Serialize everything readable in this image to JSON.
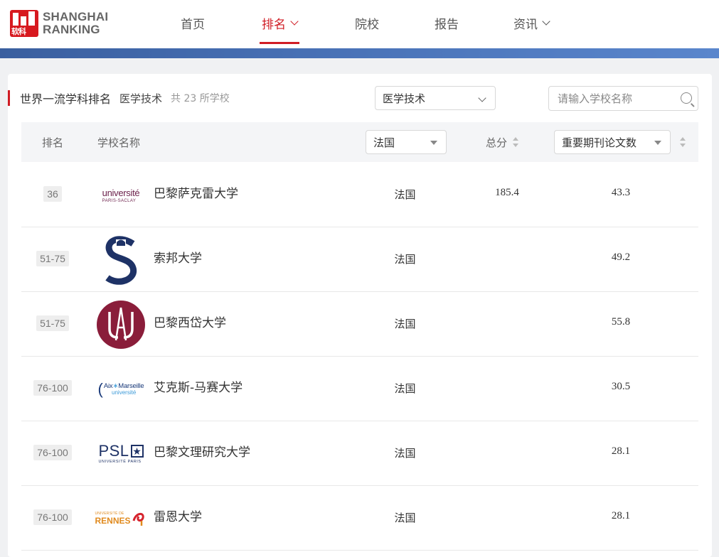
{
  "brand": {
    "cn": "软科",
    "line1": "SHANGHAI",
    "line2": "RANKING",
    "color": "#d7191f"
  },
  "nav": {
    "items": [
      {
        "label": "首页",
        "dropdown": false,
        "active": false
      },
      {
        "label": "排名",
        "dropdown": true,
        "active": true
      },
      {
        "label": "院校",
        "dropdown": false,
        "active": false
      },
      {
        "label": "报告",
        "dropdown": false,
        "active": false
      },
      {
        "label": "资讯",
        "dropdown": true,
        "active": false
      }
    ],
    "active_color": "#d01c24"
  },
  "page": {
    "title": "世界一流学科排名",
    "subject": "医学技术",
    "count": "共 23 所学校"
  },
  "subject_select": {
    "value": "医学技术"
  },
  "search": {
    "placeholder": "请输入学校名称"
  },
  "table": {
    "headers": {
      "rank": "排名",
      "name": "学校名称",
      "country_filter": "法国",
      "score": "总分",
      "indicator": "重要期刊论文数"
    },
    "rows": [
      {
        "rank": "36",
        "name": "巴黎萨克雷大学",
        "logo": "universite-paris-saclay-logo",
        "logo_text": [
          "universit",
          "PARIS-SACLAY"
        ],
        "country": "法国",
        "score": "185.4",
        "papers": "43.3"
      },
      {
        "rank": "51-75",
        "name": "索邦大学",
        "logo": "sorbonne-logo",
        "country": "法国",
        "score": "",
        "papers": "49.2"
      },
      {
        "rank": "51-75",
        "name": "巴黎西岱大学",
        "logo": "universite-paris-cite-logo",
        "country": "法国",
        "score": "",
        "papers": "55.8"
      },
      {
        "rank": "76-100",
        "name": "艾克斯-马赛大学",
        "logo": "aix-marseille-logo",
        "logo_text": [
          "Aix",
          "Marseille",
          "université"
        ],
        "country": "法国",
        "score": "",
        "papers": "30.5"
      },
      {
        "rank": "76-100",
        "name": "巴黎文理研究大学",
        "logo": "psl-logo",
        "logo_text": [
          "PSL",
          "UNIVERSITÉ PARIS"
        ],
        "country": "法国",
        "score": "",
        "papers": "28.1"
      },
      {
        "rank": "76-100",
        "name": "雷恩大学",
        "logo": "universite-de-rennes-logo",
        "logo_text": [
          "UNIVERSITÉ DE",
          "RENNES"
        ],
        "country": "法国",
        "score": "",
        "papers": "28.1"
      }
    ]
  }
}
